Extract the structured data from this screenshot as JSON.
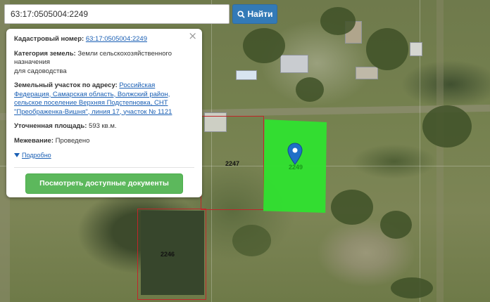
{
  "search": {
    "value": "63:17:0505004:2249",
    "button_label": "Найти"
  },
  "popup": {
    "cadastral_label": "Кадастровый номер:",
    "cadastral_value": "63:17:0505004:2249",
    "category_label": "Категория земель:",
    "category_value_1": "Земли сельскохозяйственного",
    "category_value_2": "назначения",
    "category_value_3": "для садоводства",
    "address_label": "Земельный участок по адресу:",
    "address_value_1": "Российская",
    "address_value_2": "Федерация, Самарская область, Волжский район,",
    "address_value_3": "сельское поселение Верхняя Подстепновка, СНТ",
    "address_value_4": "\"Преображенка-Вишня\", линия 17, участок № 1121",
    "area_label": "Уточненная площадь:",
    "area_value": "593 кв.м.",
    "survey_label": "Межевание:",
    "survey_value": "Проведено",
    "details_link": "Подробно",
    "docs_button": "Посмотреть доступные документы",
    "close_symbol": "×"
  },
  "map": {
    "labels": {
      "parcel_2247": "2247",
      "parcel_2246": "2246",
      "parcel_2249": "2249"
    },
    "parcel_color": "#2fe12f",
    "outline_color": "#c0262a",
    "pin_color": "#1f6fc7"
  },
  "colors": {
    "search_button": "#337ab7",
    "docs_button": "#5cb85c",
    "link": "#1a5fb4"
  }
}
